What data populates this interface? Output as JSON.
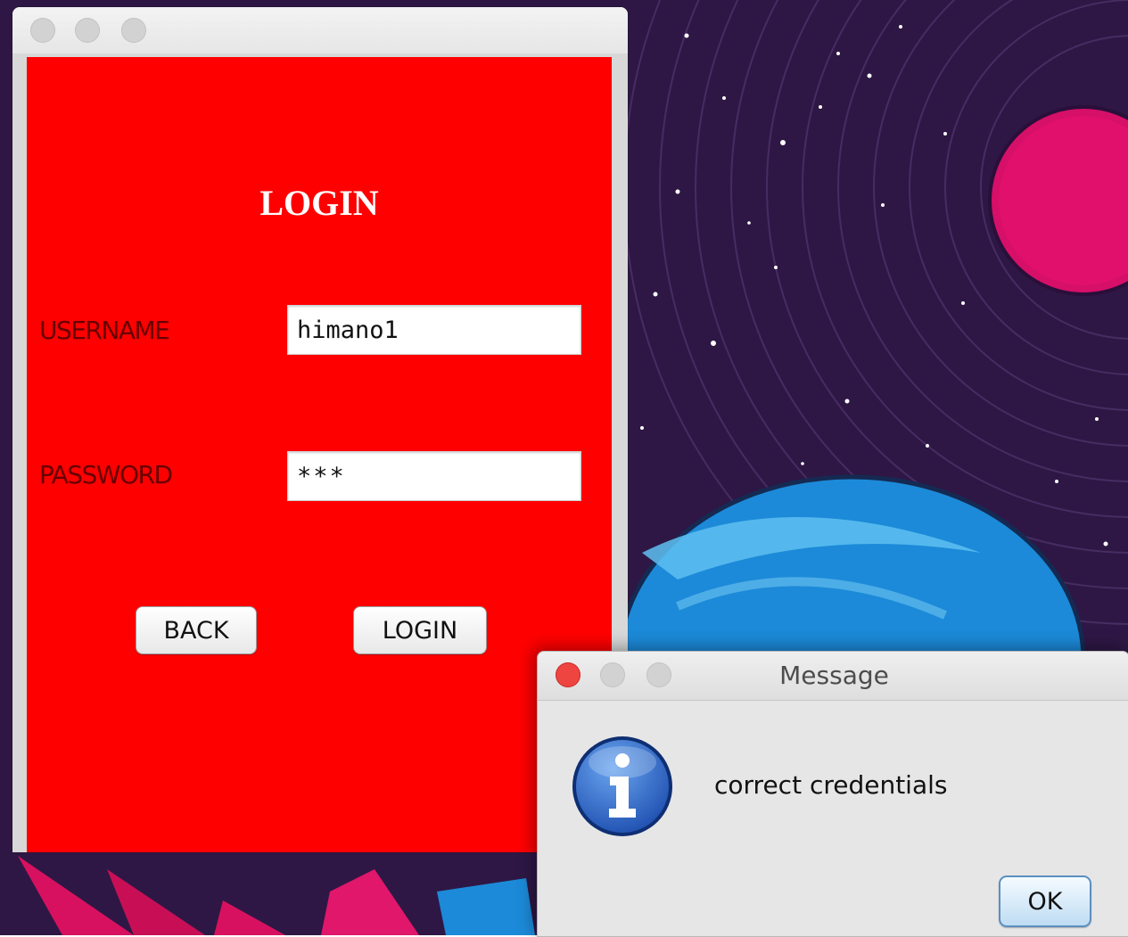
{
  "login_window": {
    "heading": "LOGIN",
    "username_label": "USERNAME",
    "username_value": "himano1",
    "password_label": "PASSWORD",
    "password_value": "***",
    "back_label": "BACK",
    "login_label": "LOGIN",
    "content_color": "#ff0000"
  },
  "message_dialog": {
    "title": "Message",
    "message": "correct credentials",
    "ok_label": "OK",
    "icon": "info-icon"
  },
  "wallpaper": {
    "background_color": "#2e1745",
    "planet_color": "#1c8ad8",
    "pink_accent": "#e0106c"
  }
}
